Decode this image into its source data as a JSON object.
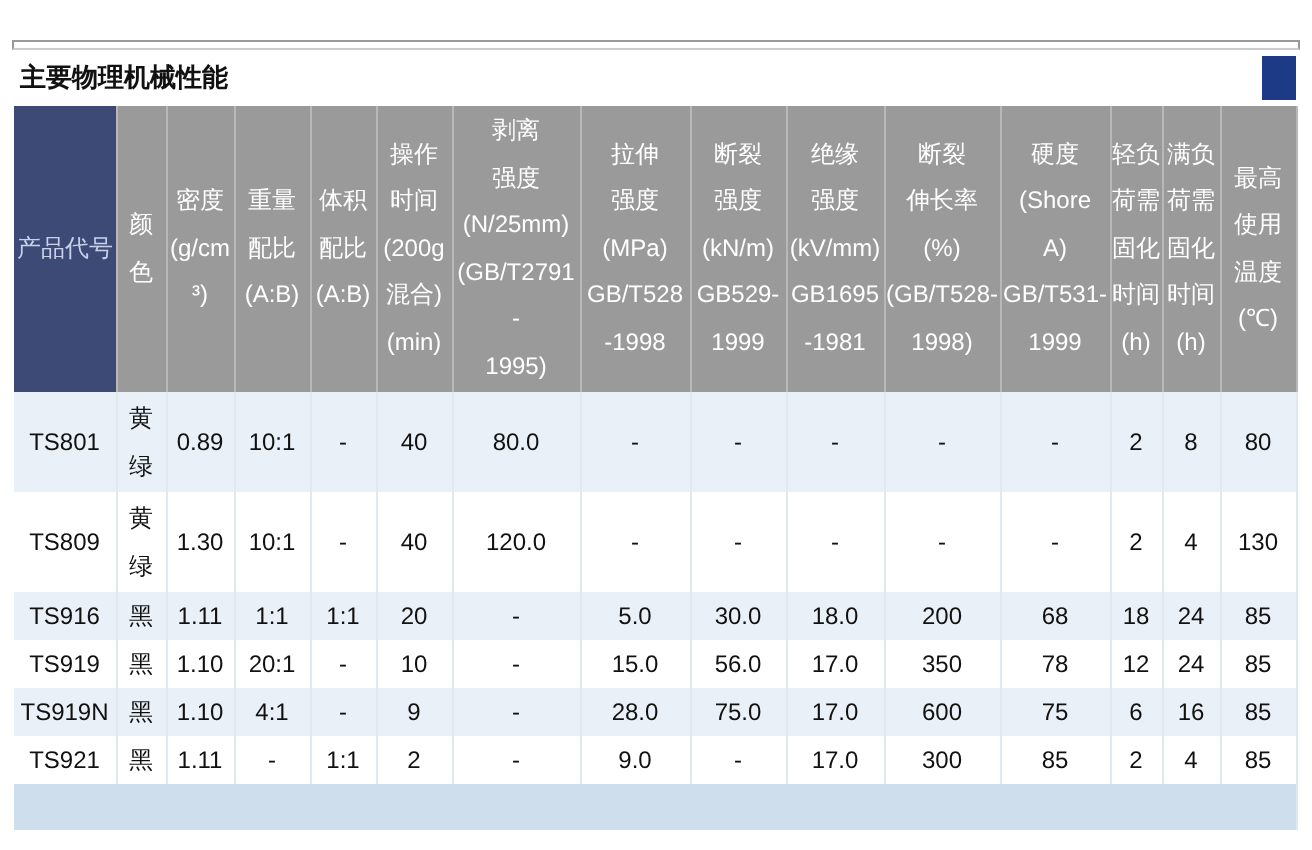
{
  "title": "主要物理机械性能",
  "table": {
    "columns": [
      "产品代号",
      "颜色",
      "密度(g/cm\n³)",
      "重量配比(A:B)",
      "体积配比(A:B)",
      "操作时间(200g\n混合)\n(min)",
      "剥离强度(N/25mm)\n(GB/T2791\n-\n1995)",
      "拉伸强度(MPa)\nGB/T528\n-1998",
      "断裂强度(kN/m)\nGB529-\n1999",
      "绝缘强度(kV/mm)\nGB1695\n-1981",
      "断裂伸长率(%)\n(GB/T528-\n1998)",
      "硬度(Shore\nA)\nGB/T531-\n1999",
      "轻负荷需固化时间(h)",
      "满负荷需固化时间(h)",
      "最高使用温度(℃)"
    ],
    "rows": [
      [
        "TS801",
        "黄绿",
        "0.89",
        "10:1",
        "-",
        "40",
        "80.0",
        "-",
        "-",
        "-",
        "-",
        "-",
        "2",
        "8",
        "80"
      ],
      [
        "TS809",
        "黄绿",
        "1.30",
        "10:1",
        "-",
        "40",
        "120.0",
        "-",
        "-",
        "-",
        "-",
        "-",
        "2",
        "4",
        "130"
      ],
      [
        "TS916",
        "黑",
        "1.11",
        "1:1",
        "1:1",
        "20",
        "-",
        "5.0",
        "30.0",
        "18.0",
        "200",
        "68",
        "18",
        "24",
        "85"
      ],
      [
        "TS919",
        "黑",
        "1.10",
        "20:1",
        "-",
        "10",
        "-",
        "15.0",
        "56.0",
        "17.0",
        "350",
        "78",
        "12",
        "24",
        "85"
      ],
      [
        "TS919N",
        "黑",
        "1.10",
        "4:1",
        "-",
        "9",
        "-",
        "28.0",
        "75.0",
        "17.0",
        "600",
        "75",
        "6",
        "16",
        "85"
      ],
      [
        "TS921",
        "黑",
        "1.11",
        "-",
        "1:1",
        "2",
        "-",
        "9.0",
        "-",
        "17.0",
        "300",
        "85",
        "2",
        "4",
        "85"
      ]
    ]
  }
}
